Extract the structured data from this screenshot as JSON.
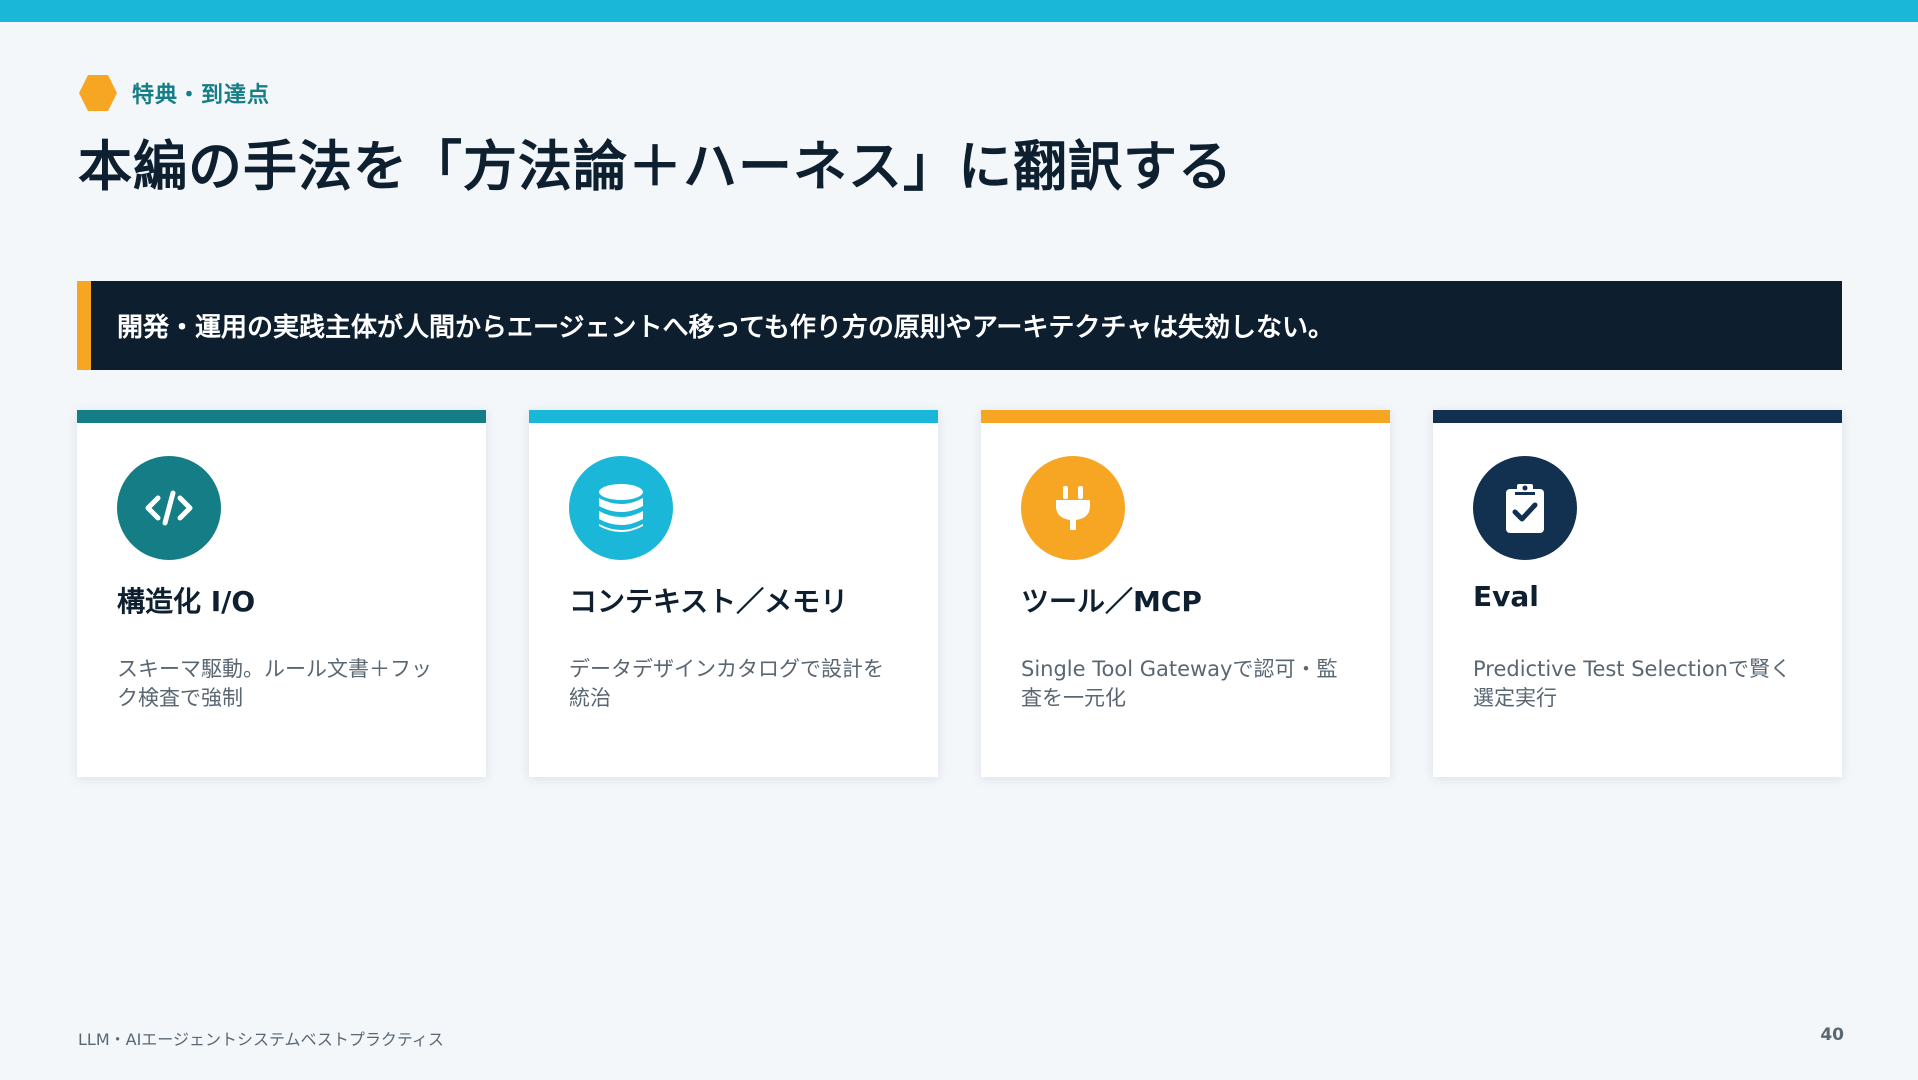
{
  "header": {
    "section_label": "特典・到達点",
    "title": "本編の手法を「方法論＋ハーネス」に翻訳する",
    "hex_color": "#f6a623"
  },
  "banner": {
    "text": "開発・運用の実践主体が人間からエージェントへ移っても作り方の原則やアーキテクチャは失効しない。",
    "accent_color": "#f6a623"
  },
  "cards": [
    {
      "title": "構造化 I/O",
      "description": "スキーマ駆動。ルール文書＋フック検査で強制",
      "icon": "code-icon",
      "color": "#157d85"
    },
    {
      "title": "コンテキスト／メモリ",
      "description": "データデザインカタログで設計を統治",
      "icon": "database-icon",
      "color": "#1ab7d8"
    },
    {
      "title": "ツール／MCP",
      "description": "Single Tool Gatewayで認可・監査を一元化",
      "icon": "plug-icon",
      "color": "#f6a623"
    },
    {
      "title": "Eval",
      "description": "Predictive Test Selectionで賢く選定実行",
      "icon": "clipboard-check-icon",
      "color": "#12304f"
    }
  ],
  "footer": {
    "text": "LLM・AIエージェントシステムベストプラクティス",
    "page_number": "40"
  }
}
